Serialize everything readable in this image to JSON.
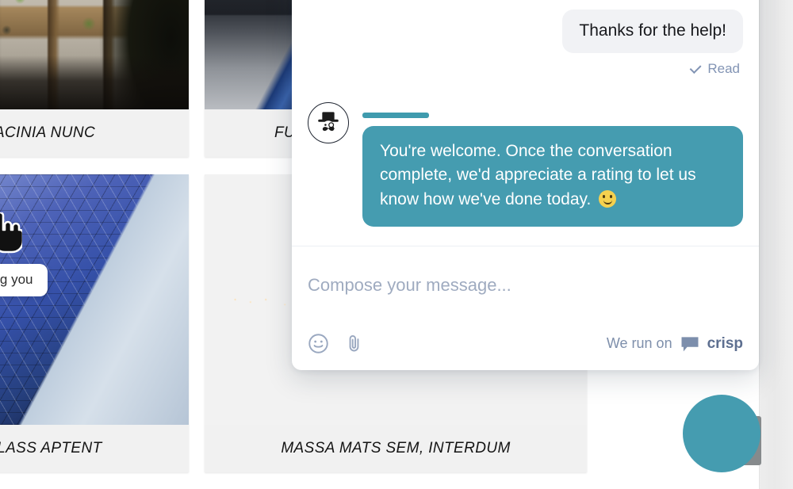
{
  "background_site": {
    "cards": [
      {
        "id": "card-top-left",
        "caption": "LACINIA NUNC",
        "image": "patio-wooden-chairs-photo"
      },
      {
        "id": "card-top-right",
        "caption": "FU",
        "image": "dark-architecture-blue-beam-photo"
      },
      {
        "id": "card-bottom-left",
        "caption": "CLASS APTENT",
        "image": "blue-triangulated-facade-photo"
      },
      {
        "id": "card-bottom-right",
        "caption": "MASSA MATS SEM, INTERDUM",
        "image": "night-harbour-photo"
      }
    ]
  },
  "cursor_tooltip": {
    "text": "s assisting you",
    "cursor": "pointing-hand-cursor"
  },
  "chat": {
    "messages": [
      {
        "author": "visitor",
        "text": "Thanks for the help!",
        "receipt": "Read",
        "receipt_icon": "check-icon"
      },
      {
        "author": "operator",
        "avatar": "top-hat-monocle-mustache-avatar",
        "name_placeholder": "",
        "text": "You're welcome. Once the conversation complete, we'd appreciate a rating to let us know how we've done today.",
        "emoji": "slightly-smiling-face"
      }
    ],
    "composer": {
      "placeholder": "Compose your message...",
      "emoji_button": "smiley-icon",
      "attach_button": "paperclip-icon"
    },
    "branding": {
      "prefix": "We run on",
      "name": "crisp",
      "logo": "crisp-speech-bubble-logo"
    },
    "close_button": {
      "label": "",
      "icon": "close-x-icon"
    },
    "colors": {
      "accent": "#459cb0",
      "visitor_bubble": "#f1f2f5",
      "receipt_text": "#8294b4",
      "placeholder_text": "#9fabc0",
      "branding_text": "#7e8fab"
    }
  }
}
